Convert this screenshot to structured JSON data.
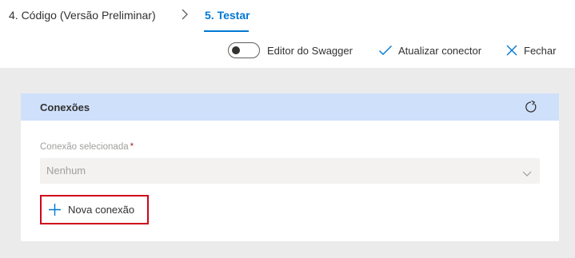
{
  "breadcrumb": {
    "steps": [
      {
        "label": "4. Código (Versão Preliminar)"
      },
      {
        "label": "5. Testar"
      }
    ]
  },
  "commandbar": {
    "swagger_toggle_label": "Editor do Swagger",
    "swagger_toggle_on": false,
    "update_label": "Atualizar conector",
    "close_label": "Fechar"
  },
  "connections": {
    "title": "Conexões",
    "field_label": "Conexão selecionada",
    "required_mark": "*",
    "selected_value": "Nenhum",
    "new_connection_label": "Nova conexão"
  },
  "colors": {
    "accent": "#0078d4",
    "header_bg": "#cfe0fb",
    "canvas_bg": "#ebebeb",
    "highlight_border": "#d0021b",
    "required": "#a4262c"
  },
  "icons": {
    "step_separator": "chevron-right-icon",
    "update": "checkmark-icon",
    "close": "close-icon",
    "refresh": "refresh-icon",
    "dropdown": "chevron-down-icon",
    "add": "plus-icon"
  }
}
